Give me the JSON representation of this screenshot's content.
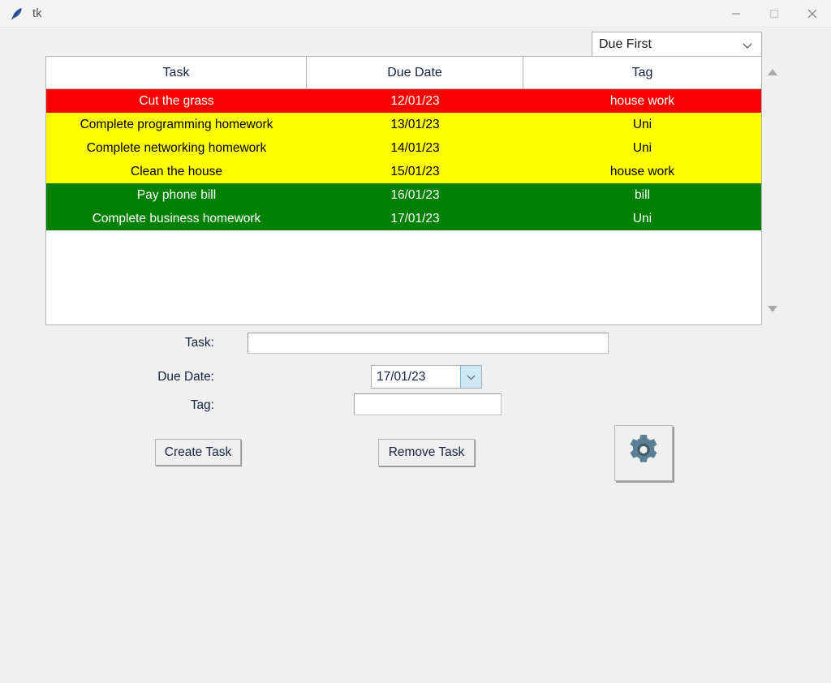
{
  "window": {
    "title": "tk",
    "icon": "feather-icon",
    "controls": [
      {
        "name": "minimize-button",
        "icon": "minimize-icon"
      },
      {
        "name": "maximize-button",
        "icon": "maximize-icon"
      },
      {
        "name": "close-button",
        "icon": "close-icon"
      }
    ]
  },
  "sort": {
    "selected": "Due First",
    "icon": "chevron-down-icon"
  },
  "table": {
    "columns": [
      "Task",
      "Due Date",
      "Tag"
    ],
    "rows": [
      {
        "task": "Cut the grass",
        "due": "12/01/23",
        "tag": "house work",
        "bg": "#fb0000",
        "fg": "#ffffff"
      },
      {
        "task": "Complete programming homework",
        "due": "13/01/23",
        "tag": "Uni",
        "bg": "#ffff00",
        "fg": "#000000"
      },
      {
        "task": "Complete networking homework",
        "due": "14/01/23",
        "tag": "Uni",
        "bg": "#ffff00",
        "fg": "#000000"
      },
      {
        "task": "Clean the house",
        "due": "15/01/23",
        "tag": "house work",
        "bg": "#ffff00",
        "fg": "#000000"
      },
      {
        "task": "Pay phone bill",
        "due": "16/01/23",
        "tag": "bill",
        "bg": "#008000",
        "fg": "#ffffff"
      },
      {
        "task": "Complete business homework",
        "due": "17/01/23",
        "tag": "Uni",
        "bg": "#008000",
        "fg": "#ffffff"
      }
    ]
  },
  "scrollbar": {
    "up_icon": "triangle-up-icon",
    "down_icon": "triangle-down-icon"
  },
  "form": {
    "task_label": "Task:",
    "task_value": "",
    "task_placeholder": "",
    "date_label": "Due Date:",
    "date_value": "17/01/23",
    "date_icon": "chevron-down-icon",
    "tag_label": "Tag:",
    "tag_value": "",
    "tag_placeholder": ""
  },
  "actions": {
    "create_label": "Create Task",
    "remove_label": "Remove Task",
    "settings_icon": "gear-icon"
  },
  "colors": {
    "overdue": "#fb0000",
    "soon": "#ffff00",
    "ok": "#008000",
    "window_bg": "#f0f0f0",
    "gear": "#52758c"
  }
}
